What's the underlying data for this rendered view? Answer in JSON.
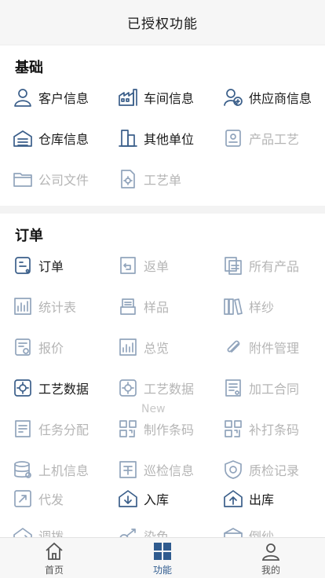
{
  "header": {
    "title": "已授权功能"
  },
  "sections": {
    "basic": {
      "title": "基础",
      "items": [
        {
          "label": "客户信息",
          "icon": "customer-icon",
          "enabled": true
        },
        {
          "label": "车间信息",
          "icon": "factory-icon",
          "enabled": true
        },
        {
          "label": "供应商信息",
          "icon": "supplier-icon",
          "enabled": true
        },
        {
          "label": "仓库信息",
          "icon": "warehouse-icon",
          "enabled": true
        },
        {
          "label": "其他单位",
          "icon": "building-icon",
          "enabled": true
        },
        {
          "label": "产品工艺",
          "icon": "product-process-icon",
          "enabled": false
        },
        {
          "label": "公司文件",
          "icon": "folder-icon",
          "enabled": false
        },
        {
          "label": "工艺单",
          "icon": "process-sheet-icon",
          "enabled": false
        }
      ]
    },
    "order": {
      "title": "订单",
      "items": [
        {
          "label": "订单",
          "icon": "order-icon",
          "enabled": true
        },
        {
          "label": "返单",
          "icon": "return-order-icon",
          "enabled": false
        },
        {
          "label": "所有产品",
          "icon": "all-products-icon",
          "enabled": false
        },
        {
          "label": "统计表",
          "icon": "statistics-icon",
          "enabled": false
        },
        {
          "label": "样品",
          "icon": "sample-icon",
          "enabled": false
        },
        {
          "label": "样纱",
          "icon": "yarn-sample-icon",
          "enabled": false
        },
        {
          "label": "报价",
          "icon": "quote-icon",
          "enabled": false
        },
        {
          "label": "总览",
          "icon": "overview-icon",
          "enabled": false
        },
        {
          "label": "附件管理",
          "icon": "attachment-icon",
          "enabled": false
        },
        {
          "label": "工艺数据",
          "icon": "process-data-icon",
          "enabled": true
        },
        {
          "label": "工艺数据",
          "icon": "process-data-icon",
          "enabled": false
        },
        {
          "label": "加工合同",
          "icon": "contract-icon",
          "enabled": false
        },
        {
          "label": "任务分配",
          "icon": "task-icon",
          "enabled": false
        },
        {
          "label": "制作条码",
          "icon": "qrcode-icon",
          "enabled": false
        },
        {
          "label": "补打条码",
          "icon": "qrcode-icon",
          "enabled": false
        },
        {
          "label": "上机信息",
          "icon": "database-icon",
          "enabled": false
        },
        {
          "label": "巡检信息",
          "icon": "inspection-icon",
          "enabled": false
        },
        {
          "label": "质检记录",
          "icon": "quality-icon",
          "enabled": false
        },
        {
          "label": "代发",
          "icon": "dispatch-icon",
          "enabled": false
        },
        {
          "label": "入库",
          "icon": "stock-in-icon",
          "enabled": true
        },
        {
          "label": "出库",
          "icon": "stock-out-icon",
          "enabled": true
        },
        {
          "label": "调拨",
          "icon": "transfer-icon",
          "enabled": false
        },
        {
          "label": "染色",
          "icon": "dye-icon",
          "enabled": false
        },
        {
          "label": "倒纱",
          "icon": "rewind-icon",
          "enabled": false
        }
      ],
      "new_badge": "New"
    }
  },
  "tabbar": {
    "tabs": [
      {
        "label": "首页",
        "icon": "home-icon",
        "active": false
      },
      {
        "label": "功能",
        "icon": "grid-icon",
        "active": true
      },
      {
        "label": "我的",
        "icon": "user-icon",
        "active": false
      }
    ]
  },
  "colors": {
    "accent": "#2f5b8f",
    "icon": "#3b5f8a",
    "disabled_text": "#b5b5b5"
  }
}
